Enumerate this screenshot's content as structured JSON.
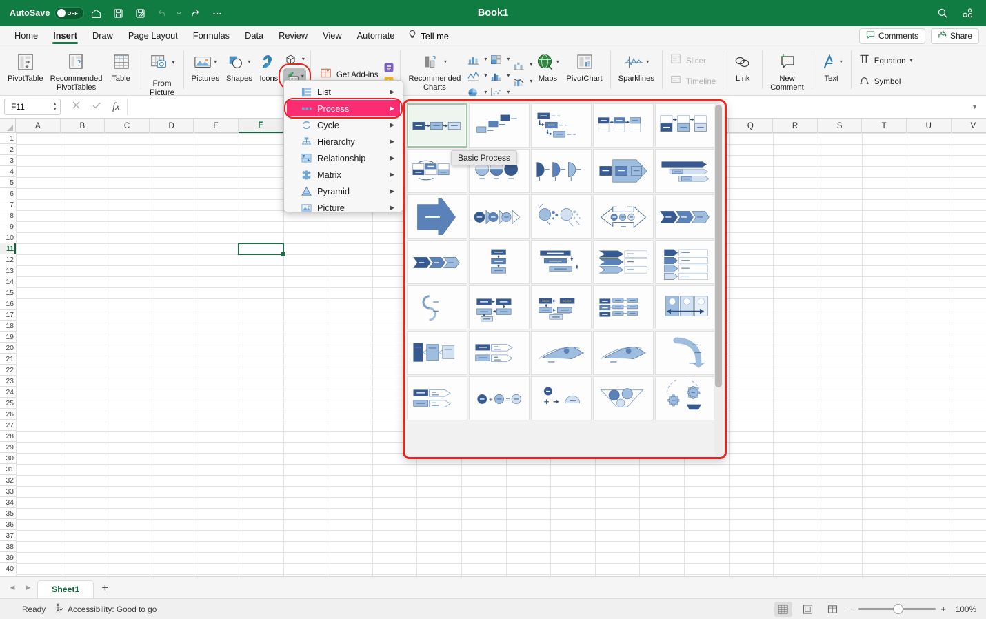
{
  "titlebar": {
    "autosave_label": "AutoSave",
    "toggle_state": "OFF",
    "document_title": "Book1",
    "icons": [
      "home-icon",
      "save-icon",
      "save-as-icon",
      "undo-icon",
      "undo-dropdown-icon",
      "redo-icon",
      "more-icon"
    ],
    "search_icon": "search-icon",
    "account_icon": "people-icon"
  },
  "tabs": [
    {
      "label": "Home",
      "active": false
    },
    {
      "label": "Insert",
      "active": true
    },
    {
      "label": "Draw",
      "active": false
    },
    {
      "label": "Page Layout",
      "active": false
    },
    {
      "label": "Formulas",
      "active": false
    },
    {
      "label": "Data",
      "active": false
    },
    {
      "label": "Review",
      "active": false
    },
    {
      "label": "View",
      "active": false
    },
    {
      "label": "Automate",
      "active": false
    }
  ],
  "tellme": {
    "label": "Tell me",
    "icon": "lightbulb-icon"
  },
  "tabbar_right": {
    "comments_label": "Comments",
    "share_label": "Share"
  },
  "ribbon": {
    "items": [
      {
        "name": "pivottable",
        "label": "PivotTable"
      },
      {
        "name": "recommended-pivottables",
        "label": "Recommended\nPivotTables"
      },
      {
        "name": "table",
        "label": "Table"
      },
      {
        "name": "from-picture",
        "label": "From\nPicture"
      },
      {
        "name": "pictures",
        "label": "Pictures"
      },
      {
        "name": "shapes",
        "label": "Shapes"
      },
      {
        "name": "icons",
        "label": "Icons"
      },
      {
        "name": "get-add-ins",
        "label": "Get Add-ins"
      },
      {
        "name": "recommended-charts",
        "label": "Recommended\nCharts"
      },
      {
        "name": "maps",
        "label": "Maps"
      },
      {
        "name": "pivotchart",
        "label": "PivotChart"
      },
      {
        "name": "sparklines",
        "label": "Sparklines"
      },
      {
        "name": "slicer",
        "label": "Slicer",
        "disabled": true
      },
      {
        "name": "timeline",
        "label": "Timeline",
        "disabled": true
      },
      {
        "name": "link",
        "label": "Link"
      },
      {
        "name": "new-comment",
        "label": "New\nComment"
      },
      {
        "name": "text",
        "label": "Text"
      },
      {
        "name": "equation",
        "label": "Equation"
      },
      {
        "name": "symbol",
        "label": "Symbol"
      }
    ],
    "smartart_highlight_color": "#e8251f"
  },
  "formulabar": {
    "cell_reference": "F11",
    "cancel_icon": "cancel-icon",
    "confirm_icon": "confirm-icon",
    "fx_label": "fx",
    "formula_value": "",
    "expand_icon": "chevron-down-icon"
  },
  "smartart_menu": {
    "items": [
      {
        "label": "List",
        "icon": "list-icon",
        "selected": false
      },
      {
        "label": "Process",
        "icon": "process-icon",
        "selected": true
      },
      {
        "label": "Cycle",
        "icon": "cycle-icon",
        "selected": false
      },
      {
        "label": "Hierarchy",
        "icon": "hierarchy-icon",
        "selected": false
      },
      {
        "label": "Relationship",
        "icon": "relationship-icon",
        "selected": false
      },
      {
        "label": "Matrix",
        "icon": "matrix-icon",
        "selected": false
      },
      {
        "label": "Pyramid",
        "icon": "pyramid-icon",
        "selected": false
      },
      {
        "label": "Picture",
        "icon": "picture-icon",
        "selected": false
      }
    ],
    "selected_color": "#fb2c72",
    "highlight_color": "#e8251f"
  },
  "gallery": {
    "tooltip": "Basic Process",
    "selected_index": 0,
    "rows": 9,
    "columns": 5,
    "highlight_color": "#e8251f",
    "items": [
      "basic-process",
      "step-down-process",
      "circle-accent-timeline",
      "accent-process",
      "picture-accent-process",
      "continuous-block-process",
      "increasing-circle-process",
      "basic-chevron-process",
      "arrow-ribbon",
      "sub-step-process",
      "basic-arrow-process",
      "circle-arrow-process",
      "random-to-result-process",
      "process-arrows",
      "chevron-list",
      "staggered-process",
      "vertical-process",
      "descending-process",
      "vertical-chevron-list",
      "step-up-process",
      "alternating-flow",
      "repeating-bending-process",
      "vertical-bending-process",
      "phased-process",
      "gear-process",
      "converging-text",
      "process-list",
      "circle-process",
      "upward-arrow",
      "descending-block-list",
      "funnel-process",
      "equation-process",
      "vertical-equation",
      "gear-list",
      "circle-gear-process"
    ]
  },
  "grid": {
    "columns": [
      "A",
      "B",
      "C",
      "D",
      "E",
      "F",
      "G",
      "H",
      "I",
      "J",
      "K",
      "L",
      "M",
      "N",
      "O",
      "P",
      "Q",
      "R",
      "S",
      "T",
      "U",
      "V"
    ],
    "selected_column": "F",
    "selected_row": 11,
    "selected_cell": "F11",
    "first_row": 1,
    "last_row": 41
  },
  "sheetbar": {
    "prev_icon": "nav-prev-icon",
    "next_icon": "nav-next-icon",
    "sheets": [
      {
        "name": "Sheet1",
        "active": true
      }
    ],
    "add_label": "+"
  },
  "statusbar": {
    "mode": "Ready",
    "accessibility": "Accessibility: Good to go",
    "views": [
      "normal-view-icon",
      "page-layout-icon",
      "page-break-icon"
    ],
    "active_view": 0,
    "zoom_out": "−",
    "zoom_in": "+",
    "zoom_level": "100%"
  }
}
